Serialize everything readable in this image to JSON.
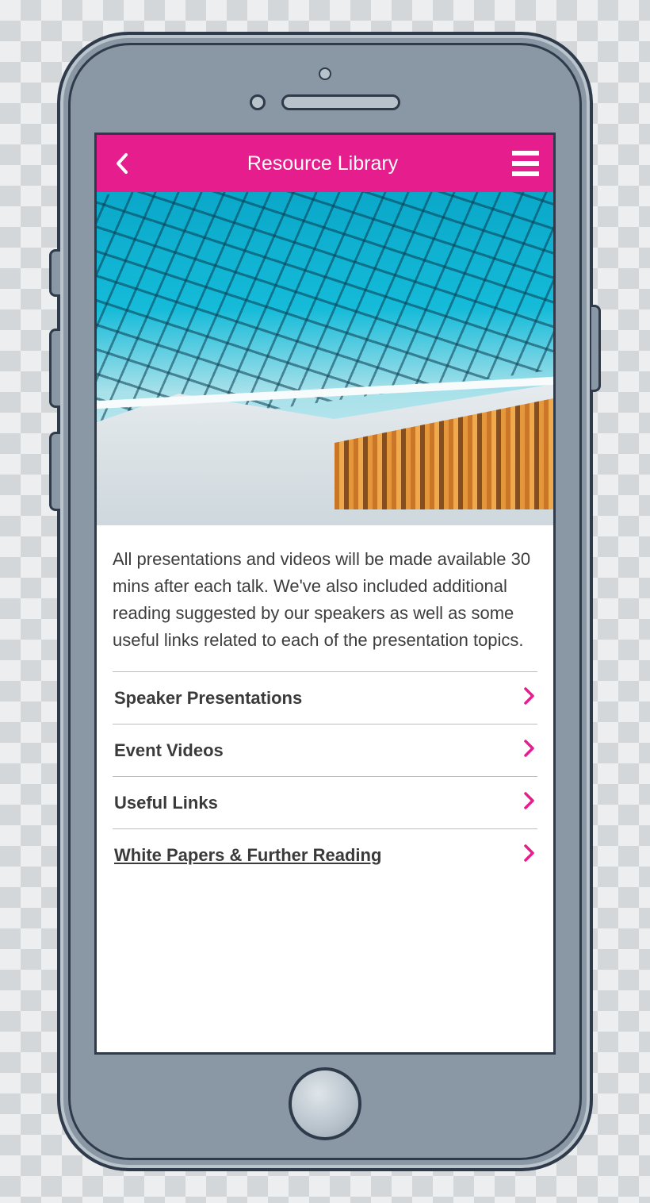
{
  "header": {
    "title": "Resource Library"
  },
  "intro": "All presentations and videos will be made available 30 mins after each talk. We've also included additional reading suggested by our speakers as well as some useful links related to each of the presentation topics.",
  "menu": [
    {
      "label": "Speaker Presentations"
    },
    {
      "label": "Event Videos"
    },
    {
      "label": "Useful Links"
    },
    {
      "label": "White Papers & Further Reading"
    }
  ],
  "colors": {
    "accent": "#e61d8c"
  }
}
